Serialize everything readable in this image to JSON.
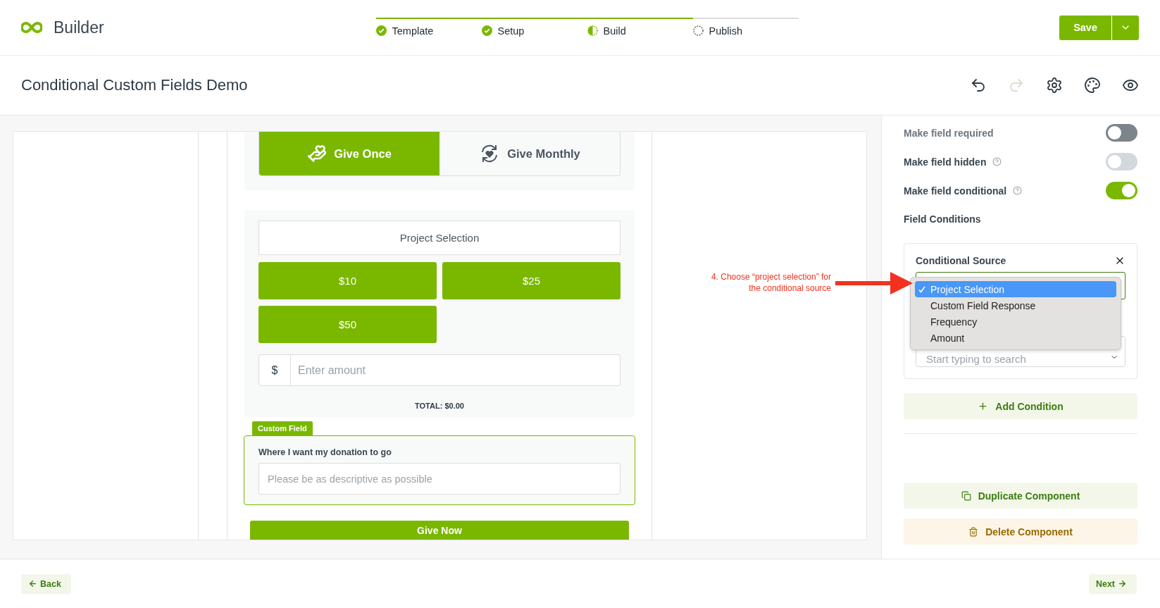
{
  "app": {
    "name": "Builder"
  },
  "steps": [
    {
      "label": "Template",
      "kind": "done"
    },
    {
      "label": "Setup",
      "kind": "done"
    },
    {
      "label": "Build",
      "kind": "partial"
    },
    {
      "label": "Publish",
      "kind": "pending"
    }
  ],
  "save_button": {
    "label": "Save"
  },
  "page": {
    "title": "Conditional Custom Fields Demo",
    "redo_disabled": true
  },
  "form": {
    "frequency_tabs": [
      {
        "label": "Give Once",
        "kind": "once",
        "selected": true
      },
      {
        "label": "Give Monthly",
        "kind": "monthly",
        "selected": false
      }
    ],
    "project_selection": "Project Selection",
    "amounts": [
      "$10",
      "$25",
      "$50"
    ],
    "currency": "$",
    "amount_placeholder": "Enter amount",
    "total": "TOTAL: $0.00",
    "custom_field": {
      "tag": "Custom Field",
      "label": "Where I want my donation to go",
      "placeholder": "Please be as descriptive as possible"
    },
    "submit": "Give Now"
  },
  "annotation": {
    "lines": [
      "4. Choose “project selection” for",
      "the conditional source"
    ]
  },
  "settings": {
    "toggles": [
      {
        "label": "Make field required",
        "on": false,
        "help": false,
        "disabled": true
      },
      {
        "label": "Make field hidden",
        "on": false,
        "help": true,
        "disabled": false
      },
      {
        "label": "Make field conditional",
        "on": true,
        "help": true,
        "disabled": false
      }
    ],
    "conditions_heading": "Field Conditions",
    "condition": {
      "title": "Conditional Source",
      "search_placeholder": "Start typing to search",
      "options": [
        {
          "label": "Project Selection",
          "selected": true
        },
        {
          "label": "Custom Field Response",
          "selected": false
        },
        {
          "label": "Frequency",
          "selected": false
        },
        {
          "label": "Amount",
          "selected": false
        }
      ]
    },
    "add_condition": "Add Condition",
    "duplicate": "Duplicate Component",
    "delete": "Delete Component"
  },
  "footer": {
    "back": "Back",
    "next": "Next"
  }
}
